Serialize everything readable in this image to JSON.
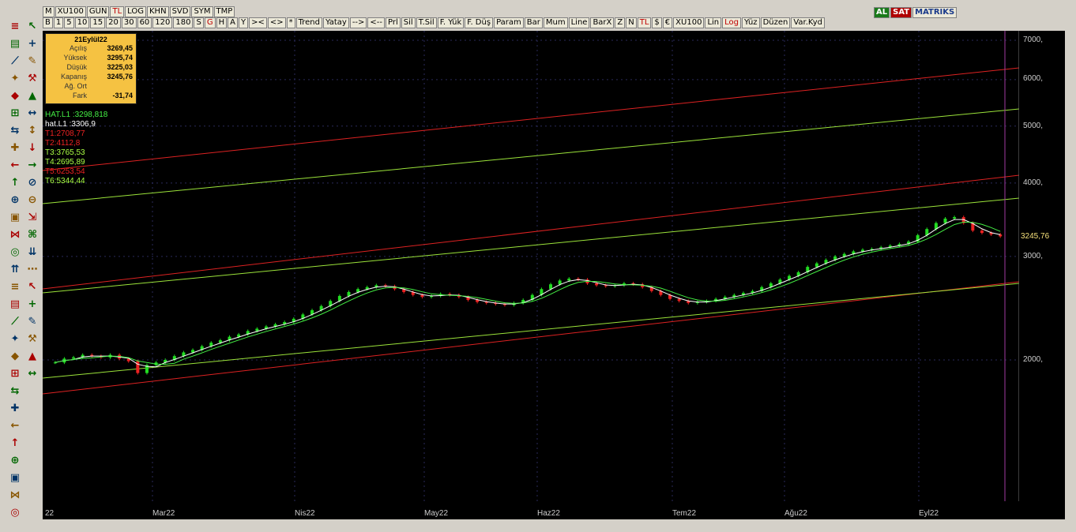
{
  "toolbar_top": [
    "M",
    "XU100",
    "GUN",
    "TL",
    "LOG",
    "KHN",
    "SVD",
    "SYM",
    "TMP"
  ],
  "toolbar_bottom": [
    "B",
    "1",
    "5",
    "10",
    "15",
    "20",
    "30",
    "60",
    "120",
    "180",
    "S",
    "G",
    "H",
    "A",
    "Y",
    "><",
    "<>",
    "*",
    "Trend",
    "Yatay",
    "-->",
    "<--",
    "Prl",
    "Sil",
    "T.Sil",
    "F. Yük",
    "F. Düş",
    "Param",
    "Bar",
    "Mum",
    "Line",
    "BarX",
    "Z",
    "N",
    "TL",
    "$",
    "€",
    "XU100",
    "Lin",
    "Log",
    "Yüz",
    "Düzen",
    "Var.Kyd"
  ],
  "top_right": {
    "al": "AL",
    "sat": "SAT",
    "brand": "MATRIKS"
  },
  "info_box": {
    "title": "21Eylül22",
    "rows": [
      {
        "k": "Açılış",
        "v": "3269,45"
      },
      {
        "k": "Yüksek",
        "v": "3295,74"
      },
      {
        "k": "Düşük",
        "v": "3225,03"
      },
      {
        "k": "Kapanış",
        "v": "3245,76"
      },
      {
        "k": "Ağ. Ort",
        "v": ""
      },
      {
        "k": "Fark",
        "v": "-31,74"
      }
    ]
  },
  "line_labels": [
    {
      "text": "HAT.L1        :3298,818",
      "color": "#44ee44"
    },
    {
      "text": "hat.L1        :3306,9",
      "color": "#ffffff"
    },
    {
      "text": "T1:2708,77",
      "color": "#ee2222"
    },
    {
      "text": "T2:4112,8",
      "color": "#ee2222"
    },
    {
      "text": "T3:3765,53",
      "color": "#aaff44"
    },
    {
      "text": "T4:2695,89",
      "color": "#aaff44"
    },
    {
      "text": "T5:6253,54",
      "color": "#ee2222"
    },
    {
      "text": "T6:5344,44",
      "color": "#aaff44"
    }
  ],
  "y_ticks": [
    "7000,",
    "6000,",
    "5000,",
    "4000,",
    "3000,",
    "2000,"
  ],
  "x_ticks": [
    "22",
    "Mar22",
    "Nis22",
    "May22",
    "Haz22",
    "Tem22",
    "Ağu22",
    "Eyl22"
  ],
  "last_price": "3245,76",
  "colors": {
    "up": "#22dd22",
    "down": "#ee2222",
    "channel_red": "#dd2222",
    "channel_green": "#9be33a",
    "ma": "#ffffff"
  },
  "chart_data": {
    "type": "candlestick",
    "symbol": "XU100",
    "scale": "log",
    "ylim": [
      1500,
      7300
    ],
    "x_months": [
      "Mar22",
      "Nis22",
      "May22",
      "Haz22",
      "Tem22",
      "Ağu22",
      "Eyl22"
    ],
    "close": [
      1980,
      2010,
      2020,
      2040,
      2030,
      2020,
      2040,
      2010,
      1990,
      1900,
      1960,
      1980,
      2000,
      2030,
      2060,
      2080,
      2110,
      2140,
      2160,
      2190,
      2210,
      2240,
      2260,
      2280,
      2300,
      2320,
      2350,
      2390,
      2430,
      2470,
      2520,
      2570,
      2610,
      2640,
      2660,
      2680,
      2670,
      2640,
      2610,
      2580,
      2560,
      2570,
      2590,
      2580,
      2560,
      2530,
      2510,
      2500,
      2490,
      2480,
      2500,
      2530,
      2580,
      2640,
      2690,
      2730,
      2750,
      2740,
      2700,
      2680,
      2670,
      2680,
      2700,
      2690,
      2660,
      2620,
      2580,
      2540,
      2520,
      2500,
      2510,
      2520,
      2540,
      2560,
      2580,
      2600,
      2620,
      2660,
      2700,
      2740,
      2780,
      2820,
      2880,
      2920,
      2960,
      3000,
      3030,
      3060,
      3080,
      3090,
      3110,
      3130,
      3150,
      3180,
      3260,
      3340,
      3420,
      3480,
      3500,
      3420,
      3320,
      3290,
      3270,
      3245.76
    ]
  }
}
